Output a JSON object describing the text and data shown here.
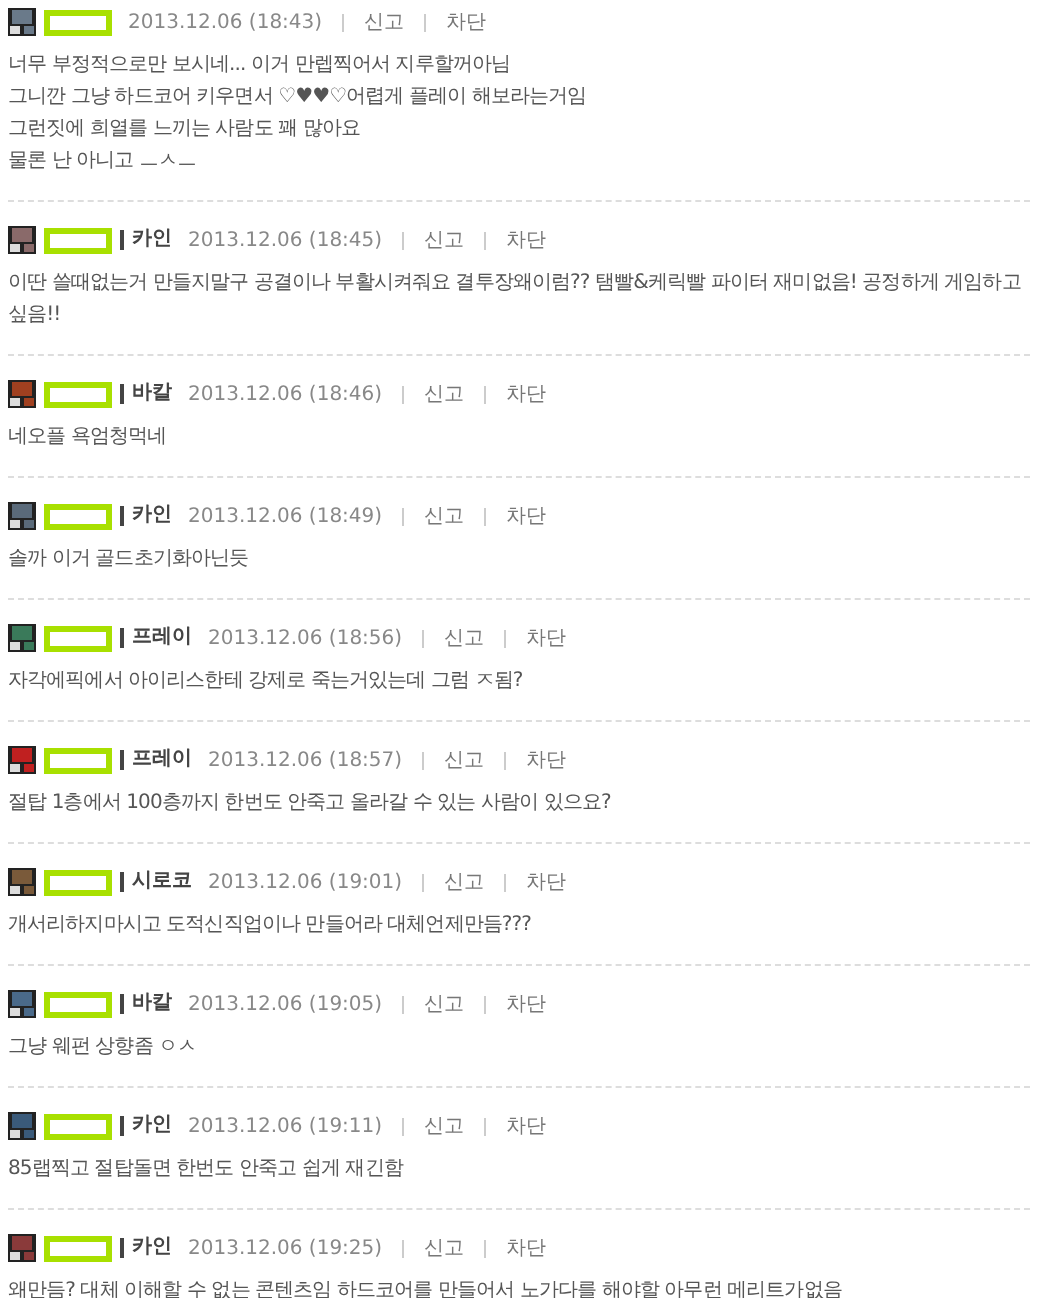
{
  "comments": [
    {
      "color": "#6a7a8a",
      "date": "2013.12.06 (18:43)",
      "report": "신고",
      "block": "차단",
      "body": "너무 부정적으로만 보시네... 이거 만렙찍어서 지루할꺼아님\n그니깐 그냥 하드코어 키우면서 ♡♥♥♡어렵게 플레이 해보라는거임\n그런짓에 희열를 느끼는 사람도 꽤 많아요\n물론 난 아니고 ㅡㅅㅡ"
    },
    {
      "color": "#8a6a6a",
      "class_name": "카인",
      "date": "2013.12.06 (18:45)",
      "report": "신고",
      "block": "차단",
      "body": "이딴 쓸때없는거 만들지말구 공결이나 부활시켜줘요 결투장왜이럼?? 탬빨&케릭빨 파이터 재미없음! 공정하게 게임하고싶음!!"
    },
    {
      "color": "#a04020",
      "class_name": "바칼",
      "date": "2013.12.06 (18:46)",
      "report": "신고",
      "block": "차단",
      "body": "네오플 욕엄청먹네"
    },
    {
      "color": "#5a6a7a",
      "class_name": "카인",
      "date": "2013.12.06 (18:49)",
      "report": "신고",
      "block": "차단",
      "body": "솔까 이거 골드초기화아닌듯"
    },
    {
      "color": "#3a7a5a",
      "class_name": "프레이",
      "date": "2013.12.06 (18:56)",
      "report": "신고",
      "block": "차단",
      "body": "자각에픽에서 아이리스한테 강제로 죽는거있는데 그럼 ㅈ됨?"
    },
    {
      "color": "#c02020",
      "class_name": "프레이",
      "date": "2013.12.06 (18:57)",
      "report": "신고",
      "block": "차단",
      "body": "절탑 1층에서 100층까지 한번도 안죽고 올라갈 수 있는 사람이 있으요?"
    },
    {
      "color": "#7a5a3a",
      "class_name": "시로코",
      "date": "2013.12.06 (19:01)",
      "report": "신고",
      "block": "차단",
      "body": "개서리하지마시고 도적신직업이나 만들어라 대체언제만듬???"
    },
    {
      "color": "#4a6a8a",
      "class_name": "바칼",
      "date": "2013.12.06 (19:05)",
      "report": "신고",
      "block": "차단",
      "body": "그냥 웨펀 상향좀 ㅇㅅ"
    },
    {
      "color": "#3a5a7a",
      "class_name": "카인",
      "date": "2013.12.06 (19:11)",
      "report": "신고",
      "block": "차단",
      "body": "85랩찍고 절탑돌면 한번도 안죽고 쉽게 재긴함"
    },
    {
      "color": "#8a3a3a",
      "class_name": "카인",
      "date": "2013.12.06 (19:25)",
      "report": "신고",
      "block": "차단",
      "body": "왜만듬? 대체 이해할 수 없는 콘텐츠임 하드코어를 만들어서 노가다를 해야할 아무런 메리트가없음"
    }
  ]
}
